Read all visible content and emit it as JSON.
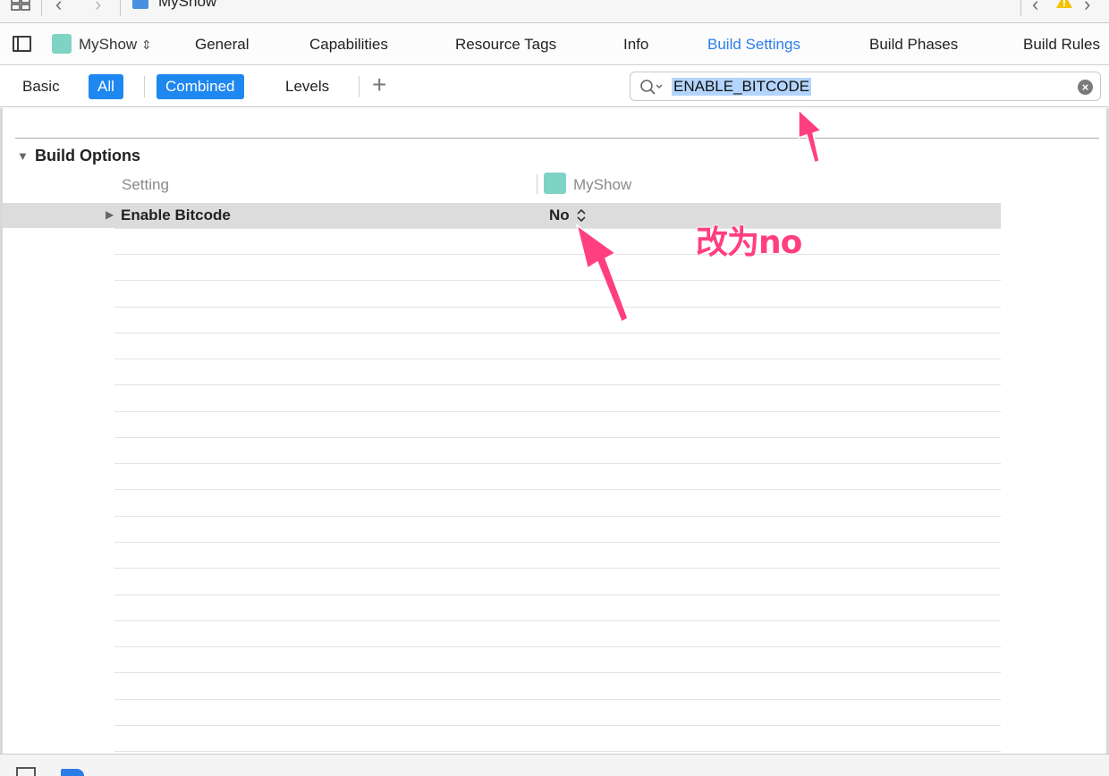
{
  "jumpbar": {
    "project_title": "MyShow",
    "back_icon": "chevron-left-icon",
    "forward_icon": "chevron-right-icon",
    "warning_color": "#f5c400"
  },
  "tabbar": {
    "target_name": "MyShow",
    "tabs": [
      {
        "label": "General"
      },
      {
        "label": "Capabilities"
      },
      {
        "label": "Resource Tags"
      },
      {
        "label": "Info"
      },
      {
        "label": "Build Settings"
      },
      {
        "label": "Build Phases"
      },
      {
        "label": "Build Rules"
      }
    ],
    "active_tab": "Build Settings",
    "accent": "#2b7de9"
  },
  "filterbar": {
    "basic": "Basic",
    "all": "All",
    "combined": "Combined",
    "levels": "Levels",
    "add": "+",
    "search_value": "ENABLE_BITCODE"
  },
  "settings": {
    "section_title": "Build Options",
    "col_setting": "Setting",
    "col_target": "MyShow",
    "rows": [
      {
        "name": "Enable Bitcode",
        "value": "No"
      }
    ]
  },
  "annotation": {
    "text": "改为no",
    "color": "#ff3f7f"
  }
}
